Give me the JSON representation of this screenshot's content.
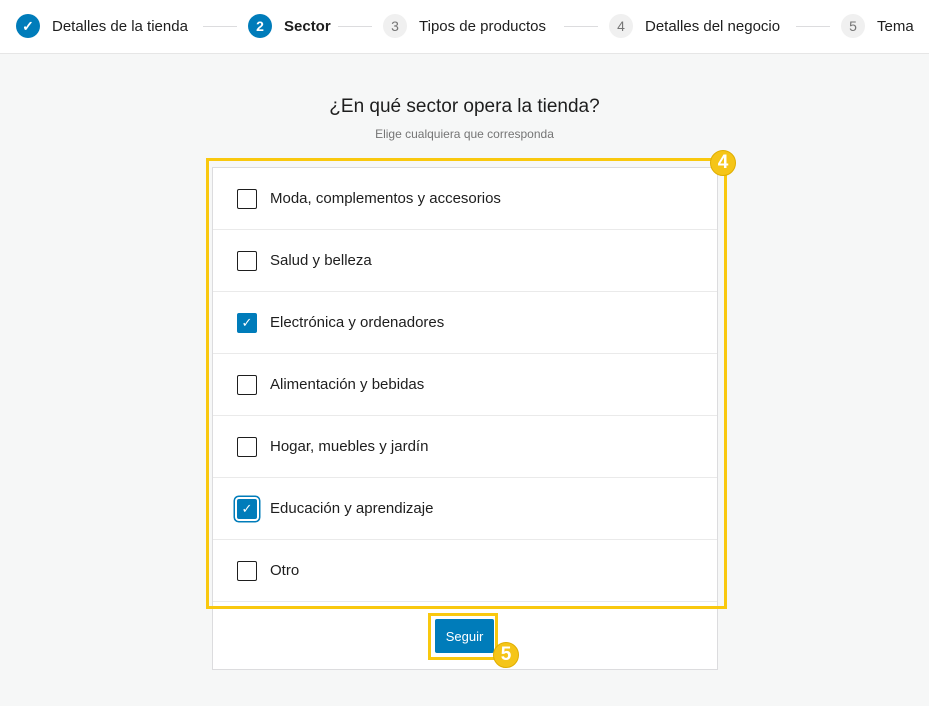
{
  "stepper": [
    {
      "number": "1",
      "label": "Detalles de la tienda",
      "state": "done"
    },
    {
      "number": "2",
      "label": "Sector",
      "state": "current"
    },
    {
      "number": "3",
      "label": "Tipos de productos",
      "state": "todo"
    },
    {
      "number": "4",
      "label": "Detalles del negocio",
      "state": "todo"
    },
    {
      "number": "5",
      "label": "Tema",
      "state": "todo"
    }
  ],
  "title": "¿En qué sector opera la tienda?",
  "subtitle": "Elige cualquiera que corresponda",
  "options": [
    {
      "label": "Moda, complementos y accesorios",
      "checked": false
    },
    {
      "label": "Salud y belleza",
      "checked": false
    },
    {
      "label": "Electrónica y ordenadores",
      "checked": true
    },
    {
      "label": "Alimentación y bebidas",
      "checked": false
    },
    {
      "label": "Hogar, muebles y jardín",
      "checked": false
    },
    {
      "label": "Educación y aprendizaje",
      "checked": true
    },
    {
      "label": "Otro",
      "checked": false
    }
  ],
  "continue_label": "Seguir",
  "annotations": {
    "options_badge": "4",
    "button_badge": "5"
  },
  "colors": {
    "accent": "#007cba",
    "highlight": "#f9c80e"
  }
}
